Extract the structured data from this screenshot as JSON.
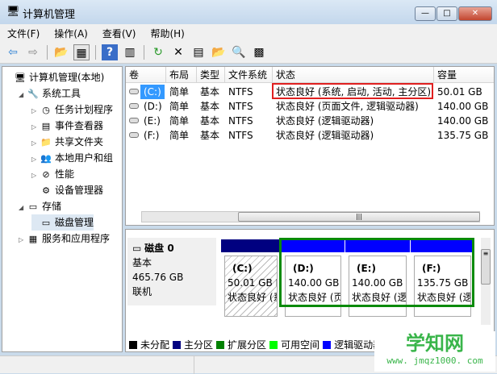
{
  "window": {
    "title": "计算机管理",
    "min": "—",
    "max": "□",
    "close": "✕"
  },
  "menu": [
    "文件(F)",
    "操作(A)",
    "查看(V)",
    "帮助(H)"
  ],
  "toolbar": [
    "back-icon",
    "forward-icon",
    "up-folder-icon",
    "show-hide-tree-icon",
    "help-icon",
    "action-pane-icon",
    "refresh-icon",
    "delete-icon",
    "properties-icon",
    "open-icon",
    "search-icon",
    "settings-icon"
  ],
  "tree": [
    {
      "label": "计算机管理(本地)",
      "level": 0,
      "icon": "🖥"
    },
    {
      "label": "系统工具",
      "level": 1,
      "icon": "🔧"
    },
    {
      "label": "任务计划程序",
      "level": 2,
      "icon": "◷"
    },
    {
      "label": "事件查看器",
      "level": 2,
      "icon": "▤"
    },
    {
      "label": "共享文件夹",
      "level": 2,
      "icon": "📁"
    },
    {
      "label": "本地用户和组",
      "level": 2,
      "icon": "👥"
    },
    {
      "label": "性能",
      "level": 2,
      "icon": "⊘"
    },
    {
      "label": "设备管理器",
      "level": 2,
      "icon": "⚙"
    },
    {
      "label": "存储",
      "level": 1,
      "icon": "▭"
    },
    {
      "label": "磁盘管理",
      "level": 2,
      "icon": "▭",
      "selected": true
    },
    {
      "label": "服务和应用程序",
      "level": 1,
      "icon": "▦"
    }
  ],
  "columns": [
    "卷",
    "布局",
    "类型",
    "文件系统",
    "状态",
    "容量"
  ],
  "rows": [
    [
      "(C:)",
      "简单",
      "基本",
      "NTFS",
      "状态良好 (系统, 启动, 活动, 主分区)",
      "50.01 GB"
    ],
    [
      "(D:)",
      "简单",
      "基本",
      "NTFS",
      "状态良好 (页面文件, 逻辑驱动器)",
      "140.00 GB"
    ],
    [
      "(E:)",
      "简单",
      "基本",
      "NTFS",
      "状态良好 (逻辑驱动器)",
      "140.00 GB"
    ],
    [
      "(F:)",
      "简单",
      "基本",
      "NTFS",
      "状态良好 (逻辑驱动器)",
      "135.75 GB"
    ]
  ],
  "disk": {
    "name": "磁盘 0",
    "type": "基本",
    "size": "465.76 GB",
    "state": "联机"
  },
  "partitions": [
    {
      "label": "(C:)",
      "size": "50.01 GB N",
      "status": "状态良好 (系"
    },
    {
      "label": "(D:)",
      "size": "140.00 GB",
      "status": "状态良好 (页"
    },
    {
      "label": "(E:)",
      "size": "140.00 GB N",
      "status": "状态良好 (逻"
    },
    {
      "label": "(F:)",
      "size": "135.75 GB",
      "status": "状态良好 (逻"
    }
  ],
  "legend": [
    {
      "label": "未分配",
      "color": "#000000"
    },
    {
      "label": "主分区",
      "color": "#000080"
    },
    {
      "label": "扩展分区",
      "color": "#008000"
    },
    {
      "label": "可用空间",
      "color": "#00ff00"
    },
    {
      "label": "逻辑驱动器",
      "color": "#0000ff"
    }
  ],
  "watermark": {
    "name": "学知网",
    "url": "www. jmqz1000. com"
  }
}
